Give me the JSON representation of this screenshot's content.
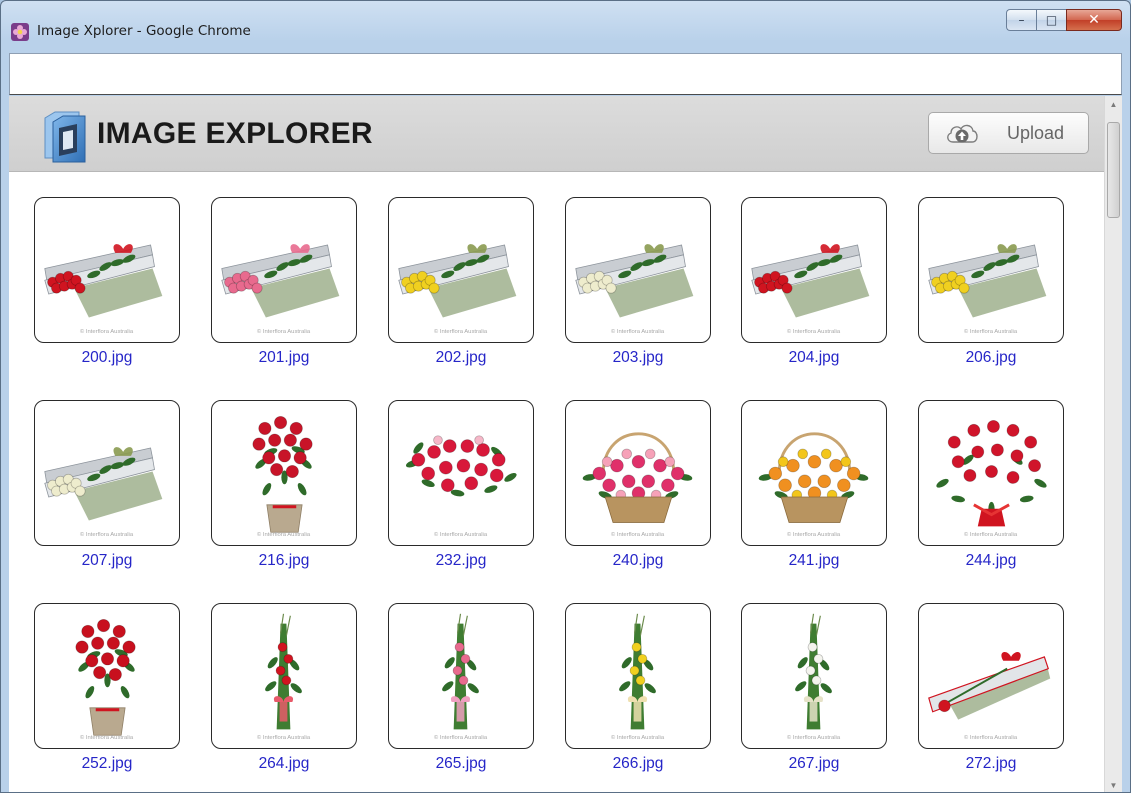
{
  "window": {
    "title": "Image Xplorer - Google Chrome",
    "controls": {
      "minimize": "–",
      "maximize": "□",
      "close": "✕"
    }
  },
  "address_bar": {
    "value": ""
  },
  "header": {
    "app_name": "IMAGE EXPLORER",
    "upload_label": "Upload",
    "icons": {
      "logo": "folder-image-icon",
      "upload": "cloud-upload-icon"
    }
  },
  "images": [
    {
      "name": "200.jpg",
      "kind": "box",
      "flower": "#d01420"
    },
    {
      "name": "201.jpg",
      "kind": "box",
      "flower": "#e86a8e"
    },
    {
      "name": "202.jpg",
      "kind": "box",
      "flower": "#f0d020"
    },
    {
      "name": "203.jpg",
      "kind": "box",
      "flower": "#eeeccd"
    },
    {
      "name": "204.jpg",
      "kind": "box",
      "flower": "#d01420"
    },
    {
      "name": "206.jpg",
      "kind": "box",
      "flower": "#f0d020"
    },
    {
      "name": "207.jpg",
      "kind": "box",
      "flower": "#eeeccd"
    },
    {
      "name": "216.jpg",
      "kind": "vase",
      "flower": "#c81428"
    },
    {
      "name": "232.jpg",
      "kind": "spray",
      "flower": "#d8183a"
    },
    {
      "name": "240.jpg",
      "kind": "basket",
      "flower": "#e0306a"
    },
    {
      "name": "241.jpg",
      "kind": "basket",
      "flower": "#f09020"
    },
    {
      "name": "244.jpg",
      "kind": "bouquet",
      "flower": "#d0142a"
    },
    {
      "name": "252.jpg",
      "kind": "vase",
      "flower": "#c8101e"
    },
    {
      "name": "264.jpg",
      "kind": "stem",
      "flower": "#d01420"
    },
    {
      "name": "265.jpg",
      "kind": "stem",
      "flower": "#e86a8e"
    },
    {
      "name": "266.jpg",
      "kind": "stem",
      "flower": "#f0d020"
    },
    {
      "name": "267.jpg",
      "kind": "stem",
      "flower": "#f4f4ee"
    },
    {
      "name": "272.jpg",
      "kind": "single-box",
      "flower": "#d01420"
    }
  ],
  "thumb_credit": "© Interflora Australia",
  "colors": {
    "link": "#2626c8",
    "header_bg": "#d6d6d6",
    "frame": "#b9d1ea"
  }
}
